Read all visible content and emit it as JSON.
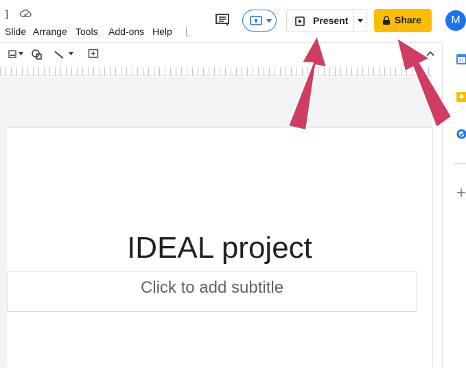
{
  "menu": {
    "items": [
      "Slide",
      "Arrange",
      "Tools",
      "Add-ons",
      "Help"
    ]
  },
  "header": {
    "present_label": "Present",
    "share_label": "Share",
    "avatar_letter": "M"
  },
  "slide": {
    "title": "IDEAL project",
    "subtitle_placeholder": "Click to add subtitle"
  },
  "colors": {
    "share_bg": "#fbbc04",
    "arrow": "#cf3d63",
    "accent": "#1a73e8"
  },
  "icons": [
    "cloud-status-icon",
    "comment-icon",
    "move-to-meet-icon",
    "present-icon",
    "dropdown-icon",
    "lock-icon",
    "calendar-icon",
    "keep-icon",
    "tasks-icon",
    "add-icon"
  ]
}
